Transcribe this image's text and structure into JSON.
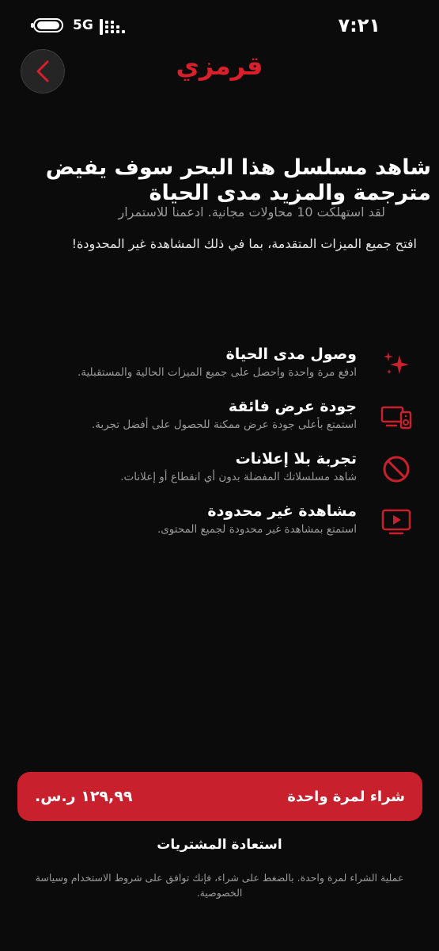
{
  "status_bar": {
    "network": "5G",
    "time": "٧:٢١"
  },
  "header": {
    "brand": "قرمزي"
  },
  "intro": {
    "headline": "شاهد مسلسل هذا البحر سوف يفيض مترجمة والمزيد مدى الحياة",
    "trial_note": "لقد استهلكت 10 محاولات مجانية. ادعمنا للاستمرار",
    "unlock_text": "افتح جميع الميزات المتقدمة، بما في ذلك المشاهدة غير المحدودة!"
  },
  "features": [
    {
      "title": "وصول مدى الحياة",
      "desc": "ادفع مرة واحدة واحصل على جميع الميزات الحالية والمستقبلية.",
      "icon": "sparkle-icon"
    },
    {
      "title": "جودة عرض فائقة",
      "desc": "استمتع بأعلى جودة عرض ممكنة للحصول على أفضل تجربة.",
      "icon": "screen-speaker-icon"
    },
    {
      "title": "تجربة بلا إعلانات",
      "desc": "شاهد مسلسلاتك المفضلة بدون أي انقطاع أو إعلانات.",
      "icon": "no-ads-icon"
    },
    {
      "title": "مشاهدة غير محدودة",
      "desc": "استمتع بمشاهدة غير محدودة لجميع المحتوى.",
      "icon": "play-screen-icon"
    }
  ],
  "purchase": {
    "price": "١٢٩,٩٩ ر.س.",
    "label": "شراء لمرة واحدة"
  },
  "restore_label": "استعادة المشتريات",
  "terms": "عملية الشراء لمرة واحدة. بالضغط على شراء، فإنك توافق على شروط الاستخدام وسياسة الخصوصية.",
  "colors": {
    "accent": "#c8202c",
    "background": "#0b0b0b",
    "muted_text": "#9a9a9a"
  }
}
